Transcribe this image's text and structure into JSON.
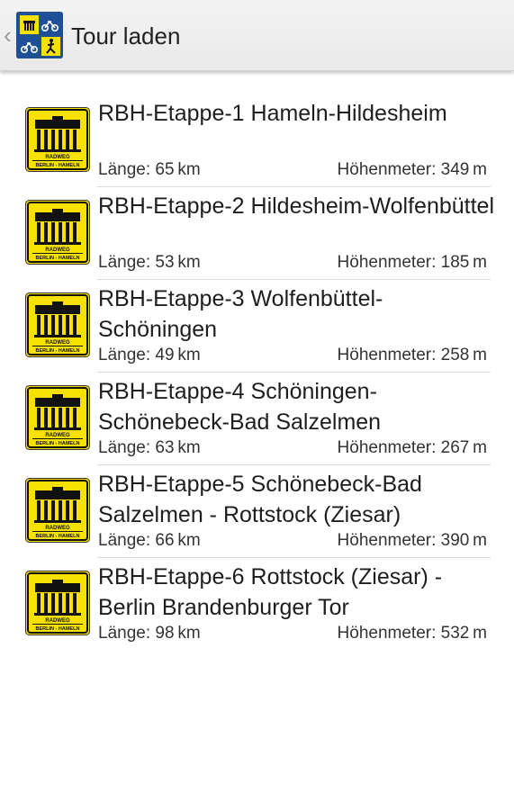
{
  "header": {
    "title": "Tour laden",
    "back_icon": "chevron-left-icon",
    "app_icon": "radweg-app-icon"
  },
  "tours": [
    {
      "title": "RBH-Etappe-1 Hameln-Hildesheim",
      "length": "Länge: 65 km",
      "elevation": "Höhenmeter: 349 m"
    },
    {
      "title": "RBH-Etappe-2 Hildesheim-Wolfenbüttel",
      "length": "Länge: 53 km",
      "elevation": "Höhenmeter: 185 m"
    },
    {
      "title": "RBH-Etappe-3 Wolfenbüttel-Schöningen",
      "length": "Länge: 49 km",
      "elevation": "Höhenmeter: 258 m"
    },
    {
      "title": "RBH-Etappe-4 Schöningen-Schönebeck-Bad Salzelmen",
      "length": "Länge: 63 km",
      "elevation": "Höhenmeter: 267 m"
    },
    {
      "title": "RBH-Etappe-5 Schönebeck-Bad Salzelmen - Rottstock (Ziesar)",
      "length": "Länge: 66 km",
      "elevation": "Höhenmeter: 390 m"
    },
    {
      "title": "RBH-Etappe-6 Rottstock (Ziesar) - Berlin Brandenburger Tor",
      "length": "Länge: 98 km",
      "elevation": "Höhenmeter: 532 m"
    }
  ],
  "sign": {
    "line1": "RADWEG",
    "line2": "BERLIN - HAMELN",
    "bg_color": "#f6e100",
    "fg_color": "#111111"
  },
  "colors": {
    "appbar": "#eeeeee",
    "app_icon_blue": "#1f4f96",
    "app_icon_yellow": "#f6e100"
  }
}
